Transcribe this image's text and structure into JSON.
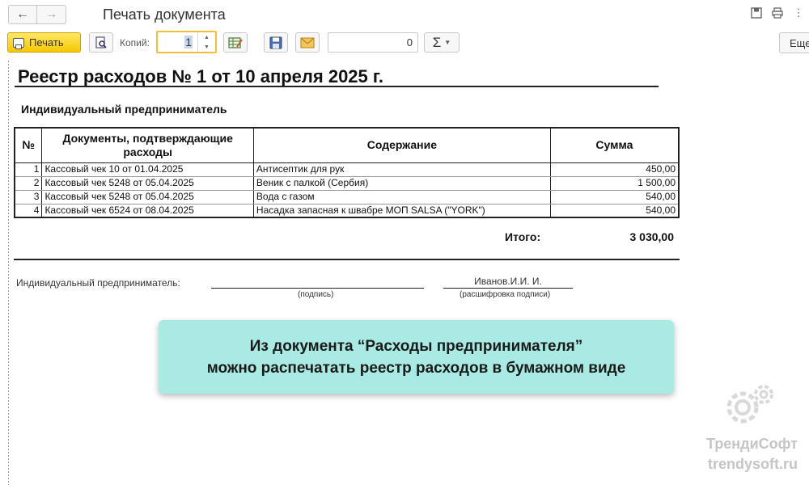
{
  "window": {
    "title": "Печать документа"
  },
  "toolbar": {
    "print_label": "Печать",
    "copies_label": "Копий:",
    "copies_value": "1",
    "number_field_value": "0",
    "sum_symbol": "Σ",
    "more_label": "Еще"
  },
  "document": {
    "title": "Реестр расходов № 1 от 10 апреля 2025 г.",
    "org": "Индивидуальный предприниматель",
    "columns": {
      "num": "№",
      "docs": "Документы, подтверждающие расходы",
      "content": "Содержание",
      "sum": "Сумма"
    },
    "rows": [
      {
        "num": "1",
        "doc": "Кассовый чек 10 от 01.04.2025",
        "content": "Антисептик для рук",
        "sum": "450,00"
      },
      {
        "num": "2",
        "doc": "Кассовый чек 5248 от 05.04.2025",
        "content": "Веник с палкой (Сербия)",
        "sum": "1 500,00"
      },
      {
        "num": "3",
        "doc": "Кассовый чек 5248 от 05.04.2025",
        "content": "Вода с газом",
        "sum": "540,00"
      },
      {
        "num": "4",
        "doc": "Кассовый чек 6524 от 08.04.2025",
        "content": "Насадка запасная к швабре МОП SALSA (\"YORK\")",
        "sum": "540,00"
      }
    ],
    "total_label": "Итого:",
    "total_value": "3 030,00",
    "signature": {
      "role": "Индивидуальный предприниматель:",
      "sign_caption": "(подпись)",
      "name": "Иванов.И.И. И.",
      "name_caption": "(расшифровка подписи)"
    }
  },
  "callout": {
    "line1": "Из документа “Расходы предпринимателя”",
    "line2": "можно распечатать реестр расходов в бумажном виде"
  },
  "watermark": {
    "brand": "ТрендиСофт",
    "site": "trendysoft.ru"
  },
  "colors": {
    "print_button": "#f5c800",
    "callout_bg": "#a9ebe4",
    "copies_border": "#f2c037"
  }
}
